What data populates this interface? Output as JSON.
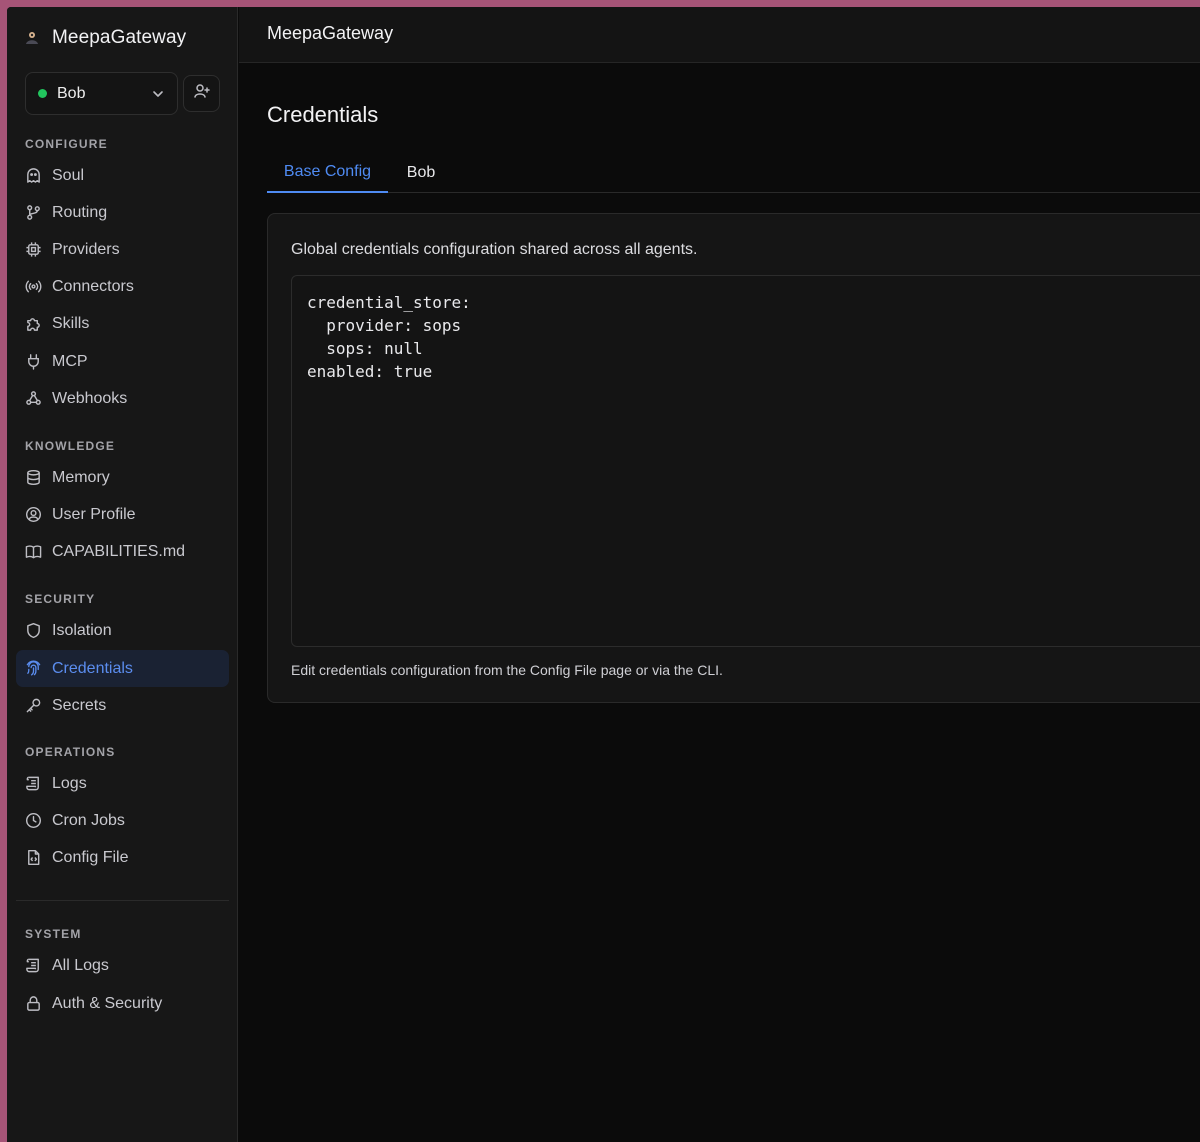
{
  "app": {
    "name": "MeepaGateway"
  },
  "agent_select": {
    "value": "Bob",
    "status_color": "#22c55e"
  },
  "sidebar": {
    "sections": {
      "configure": "CONFIGURE",
      "knowledge": "KNOWLEDGE",
      "security": "SECURITY",
      "operations": "OPERATIONS",
      "system": "SYSTEM"
    },
    "items": {
      "soul": "Soul",
      "routing": "Routing",
      "providers": "Providers",
      "connectors": "Connectors",
      "skills": "Skills",
      "mcp": "MCP",
      "webhooks": "Webhooks",
      "memory": "Memory",
      "user_profile": "User Profile",
      "capabilities": "CAPABILITIES.md",
      "isolation": "Isolation",
      "credentials": "Credentials",
      "secrets": "Secrets",
      "logs": "Logs",
      "cron_jobs": "Cron Jobs",
      "config_file": "Config File",
      "all_logs": "All Logs",
      "auth_security": "Auth & Security"
    },
    "active_item": "credentials",
    "active_color": "#5b8def"
  },
  "topbar": {
    "title": "MeepaGateway"
  },
  "page": {
    "title": "Credentials",
    "tabs": [
      {
        "label": "Base Config",
        "active": true
      },
      {
        "label": "Bob",
        "active": false
      }
    ],
    "description": "Global credentials configuration shared across all agents.",
    "config_yaml": "credential_store:\n  provider: sops\n  sops: null\nenabled: true",
    "footer": "Edit credentials configuration from the Config File page or via the CLI."
  },
  "colors": {
    "accent": "#4f8bf3",
    "background": "#0b0b0b",
    "sidebar": "#171717"
  }
}
